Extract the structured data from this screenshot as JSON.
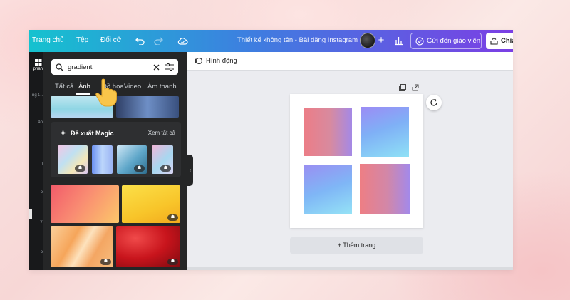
{
  "topbar": {
    "home": "Trang chủ",
    "file": "Tệp",
    "resize": "Đổi cỡ",
    "title": "Thiết kế không tên - Bài đăng Instagram",
    "send_teacher": "Gửi đến giáo viên",
    "share": "Chia"
  },
  "rail": {
    "items": [
      "phần",
      "ng t...",
      "ản",
      "n",
      "o",
      "Y",
      "o"
    ]
  },
  "panel": {
    "search": {
      "value": "gradient"
    },
    "tabs": [
      "Tất cả",
      "Ảnh",
      "Đồ họa",
      "Video",
      "Âm thanh"
    ],
    "active_tab": "Ảnh",
    "magic": {
      "title": "Đề xuất Magic",
      "see_all": "Xem tất cả"
    }
  },
  "editor": {
    "animate": "Hình động",
    "add_page": "+ Thêm trang"
  },
  "colors": {
    "topbar_start": "#15c2cf",
    "topbar_end": "#7b3fe4",
    "panel_bg": "#252627",
    "canvas_bg": "#ebecf0"
  }
}
